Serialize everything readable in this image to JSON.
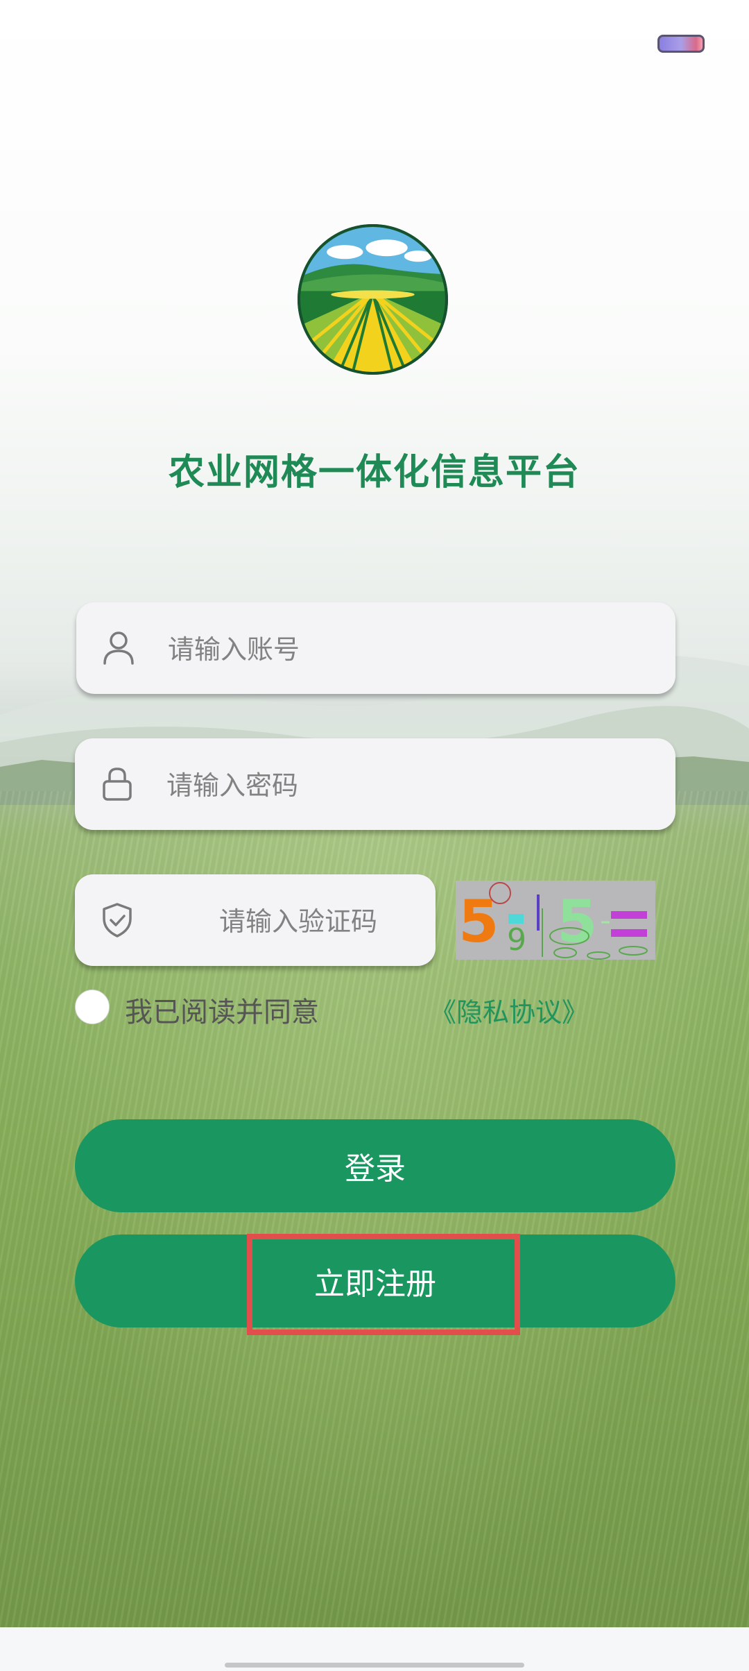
{
  "app": {
    "title": "农业网格一体化信息平台"
  },
  "status_bar": {
    "battery_icon": "battery-icon"
  },
  "form": {
    "account_placeholder": "请输入账号",
    "password_placeholder": "请输入密码",
    "captcha_placeholder": "请输入验证码",
    "captcha_image_text": "5 9 5 ="
  },
  "agreement": {
    "checked": false,
    "text": "我已阅读并同意",
    "link_text": "《隐私协议》"
  },
  "buttons": {
    "login_label": "登录",
    "register_label": "立即注册"
  },
  "colors": {
    "brand_green": "#1a9760",
    "title_green": "#1f8a55",
    "highlight_red": "#e14e4c"
  }
}
